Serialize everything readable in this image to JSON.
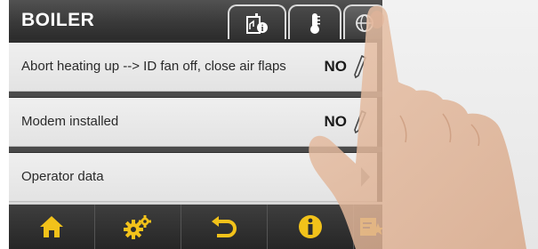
{
  "header": {
    "title": "BOILER"
  },
  "tabs": [
    {
      "icon": "boiler-info-icon"
    },
    {
      "icon": "thermometer-icon"
    },
    {
      "icon": "globe-icon",
      "active": true
    }
  ],
  "rows": [
    {
      "label": "Abort heating up --> ID fan off, close air flaps",
      "value": "NO",
      "icon": "pencil-icon"
    },
    {
      "label": "Modem installed",
      "value": "NO",
      "icon": "pencil-icon"
    },
    {
      "label": "Operator data",
      "icon": "chevron-right-icon"
    }
  ],
  "bottom_bar": [
    {
      "icon": "home-icon"
    },
    {
      "icon": "settings-gears-icon"
    },
    {
      "icon": "back-arrow-icon"
    },
    {
      "icon": "info-icon"
    },
    {
      "icon": "note-star-icon"
    }
  ],
  "colors": {
    "accent_yellow": "#f2c21a",
    "header_dark": "#333333",
    "row_bg": "#e8e8e8"
  }
}
